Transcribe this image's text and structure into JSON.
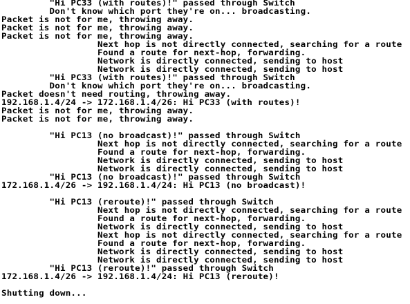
{
  "console": {
    "lines": [
      "         \"Hi PC33 (with routes)!\" passed through Switch",
      "         Don't know which port they're on... broadcasting.",
      "Packet is not for me, throwing away.",
      "Packet is not for me, throwing away.",
      "Packet is not for me, throwing away.",
      "                  Next hop is not directly connected, searching for a route",
      "                  Found a route for next-hop, forwarding.",
      "                  Network is directly connected, sending to host",
      "                  Network is directly connected, sending to host",
      "         \"Hi PC33 (with routes)!\" passed through Switch",
      "         Don't know which port they're on... broadcasting.",
      "Packet doesn't need routing, throwing away.",
      "192.168.1.4/24 -> 172.168.1.4/26: Hi PC33 (with routes)!",
      "Packet is not for me, throwing away.",
      "Packet is not for me, throwing away.",
      "",
      "         \"Hi PC13 (no broadcast)!\" passed through Switch",
      "                  Next hop is not directly connected, searching for a route",
      "                  Found a route for next-hop, forwarding.",
      "                  Network is directly connected, sending to host",
      "                  Network is directly connected, sending to host",
      "         \"Hi PC13 (no broadcast)!\" passed through Switch",
      "172.168.1.4/26 -> 192.168.1.4/24: Hi PC13 (no broadcast)!",
      "",
      "         \"Hi PC13 (reroute)!\" passed through Switch",
      "                  Next hop is not directly connected, searching for a route",
      "                  Found a route for next-hop, forwarding.",
      "                  Network is directly connected, sending to host",
      "                  Next hop is not directly connected, searching for a route",
      "                  Found a route for next-hop, forwarding.",
      "                  Network is directly connected, sending to host",
      "                  Network is directly connected, sending to host",
      "         \"Hi PC13 (reroute)!\" passed through Switch",
      "172.168.1.4/26 -> 192.168.1.4/24: Hi PC13 (reroute)!",
      "",
      "Shutting down..."
    ]
  }
}
